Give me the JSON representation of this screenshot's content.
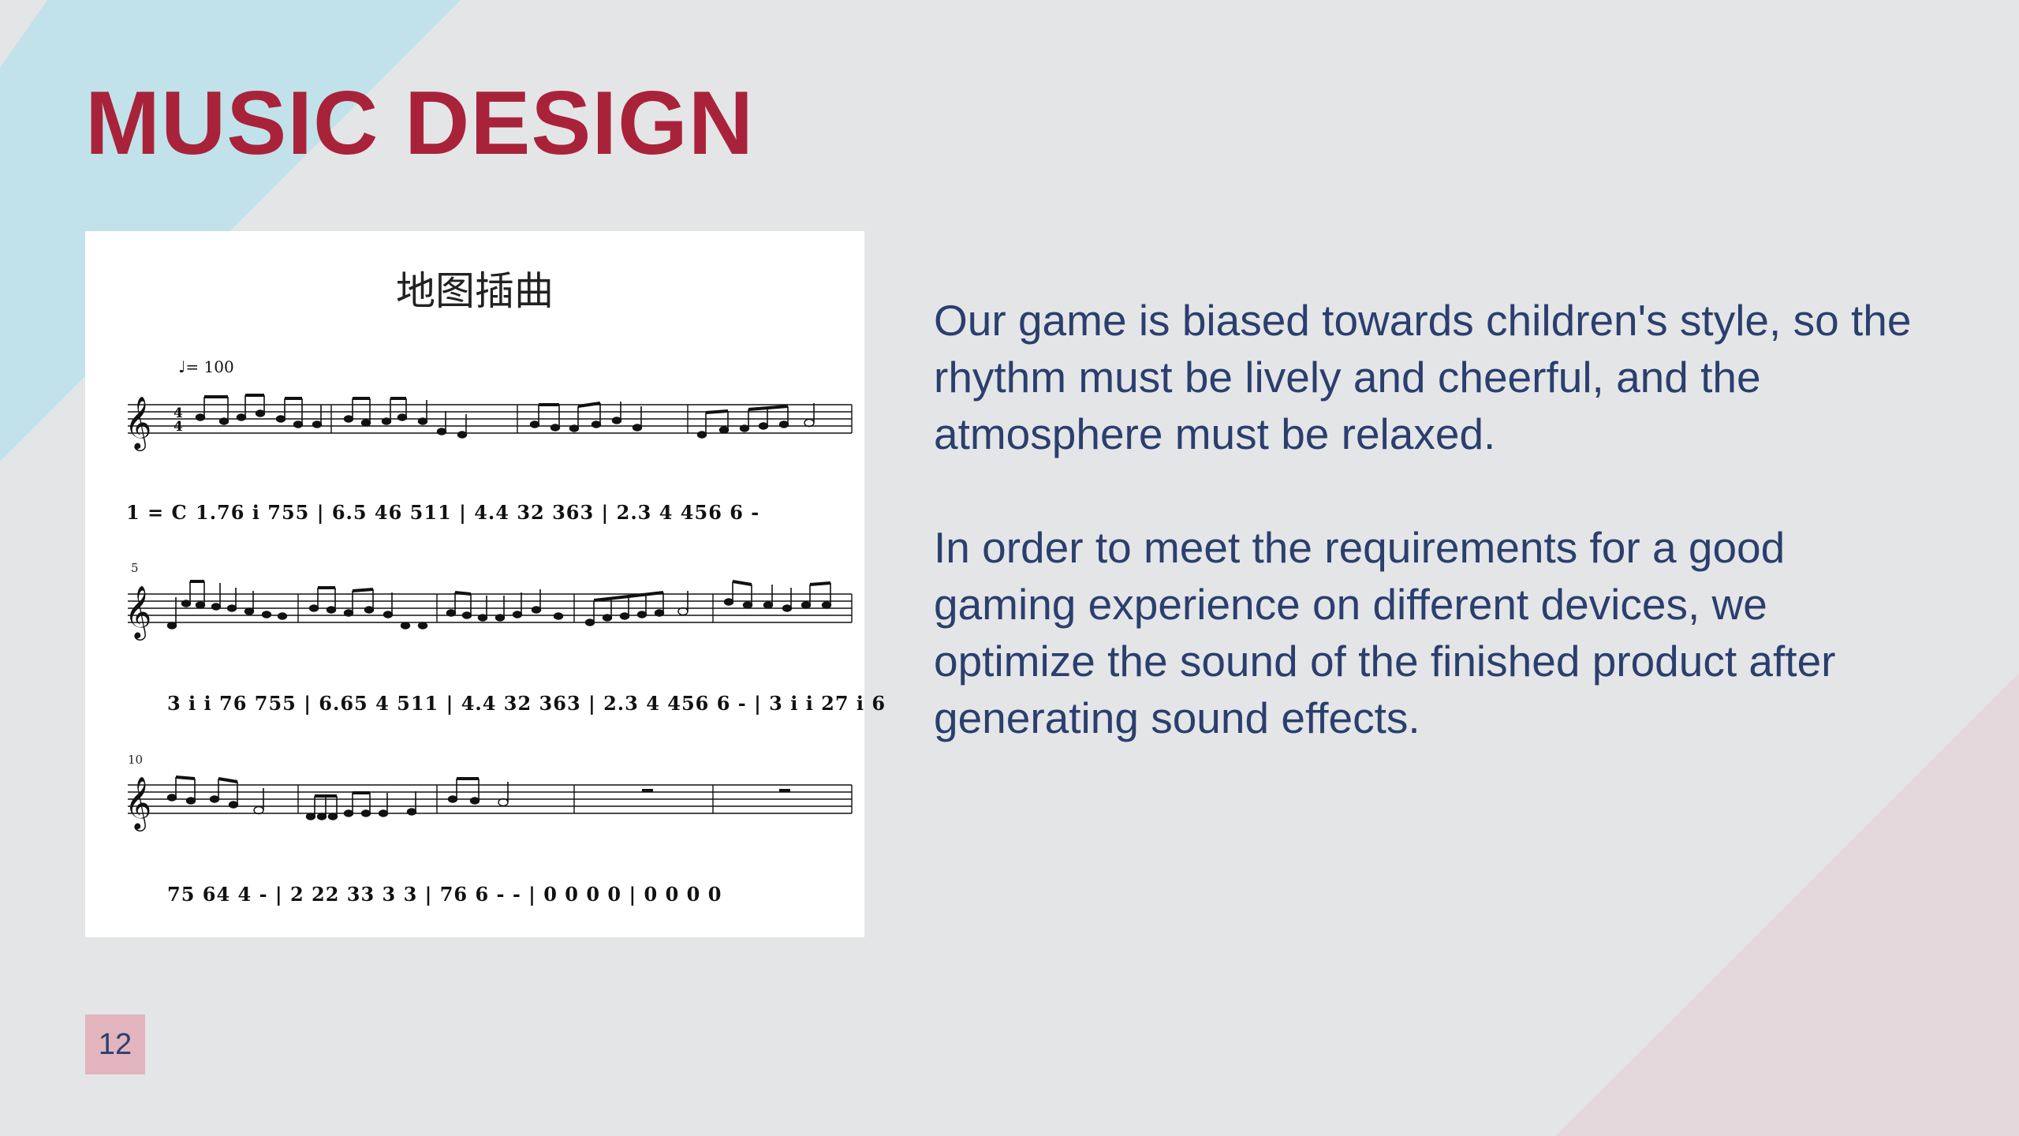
{
  "slide": {
    "title": "MUSIC DESIGN",
    "page_number": "12",
    "paragraphs": [
      "Our game is biased towards children's style, so the rhythm must be lively and cheerful, and the atmosphere must be relaxed.",
      "In order to meet the requirements for a good gaming experience on different devices, we optimize the sound of the finished product after generating sound effects."
    ],
    "colors": {
      "background": "#e4e5e7",
      "accent_blue": "#c1e2ea",
      "accent_pink": "#e5d8dc",
      "title": "#a8233a",
      "body_text": "#2b3f6e",
      "page_badge": "#e2b4bd"
    }
  },
  "score": {
    "title": "地图插曲",
    "tempo": "♩= 100",
    "key_signature": "1 = C",
    "time_signature": "4/4",
    "measure_numbers": [
      "5",
      "10"
    ],
    "lines": [
      "1.76 i 755 | 6.5 46 511 | 4.4 32 363 | 2.3 4 456 6 -",
      "3 i i 76 755 | 6.65 4 511 | 4.4 32 363 | 2.3 4 456 6 - | 3 i i 27 i 6",
      "75 64 4 - | 2 22 33 3 3 | 76 6 - - | 0 0 0 0 | 0 0 0 0"
    ]
  }
}
